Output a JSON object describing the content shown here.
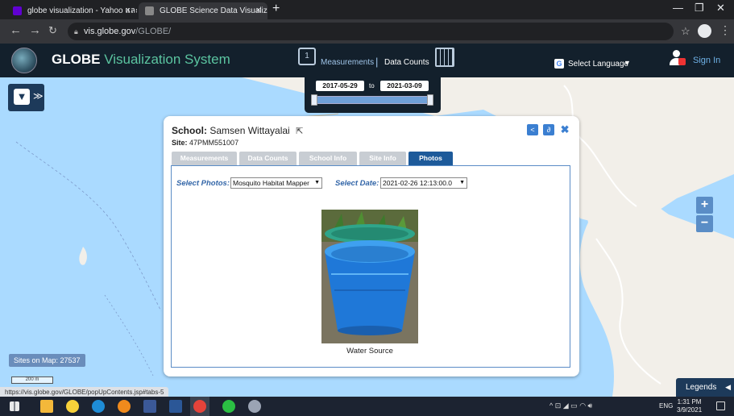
{
  "browser": {
    "tabs": [
      {
        "title": "globe visualization - Yahoo และค",
        "close": "×"
      },
      {
        "title": "GLOBE Science Data Visualization",
        "close": "×"
      }
    ],
    "new_tab": "+",
    "url_host": "vis.globe.gov",
    "url_path": "/GLOBE/"
  },
  "header": {
    "title": "GLOBE",
    "subtitle": "Visualization System",
    "measurements": "Measurements",
    "separator": "|",
    "data_counts": "Data Counts",
    "language": "Select Language",
    "language_caret": "▼",
    "sign_in": "Sign In"
  },
  "date_range": {
    "start": "2017-05-29",
    "to": "to",
    "end": "2021-03-09"
  },
  "popup": {
    "school_label": "School:",
    "school_name": "Samsen Wittayalai",
    "site_label": "Site:",
    "site_id": "47PMM551007",
    "tabs": [
      "Measurements",
      "Data Counts",
      "School Info",
      "Site Info",
      "Photos"
    ],
    "active_tab": "Photos",
    "select_photos_label": "Select Photos:",
    "select_photos_value": "Mosquito Habitat Mapper",
    "select_date_label": "Select Date:",
    "select_date_value": "2021-02-26 12:13:00.0",
    "photo_caption": "Water Source"
  },
  "map": {
    "zoom_in": "+",
    "zoom_out": "−",
    "sites_on_map": "Sites on Map: 27537",
    "scale": "200 m",
    "legends": "Legends",
    "legends_caret": "◀"
  },
  "status_url": "https://vis.globe.gov/GLOBE/popUpContents.jsp#tabs-5",
  "taskbar": {
    "tray_lang": "ENG",
    "time": "1:31 PM",
    "date": "3/9/2021"
  },
  "colors": {
    "header_bg": "#13202c",
    "accent_green": "#5bc4a0",
    "active_tab": "#1d5a9a",
    "map_water": "#aadaff"
  }
}
